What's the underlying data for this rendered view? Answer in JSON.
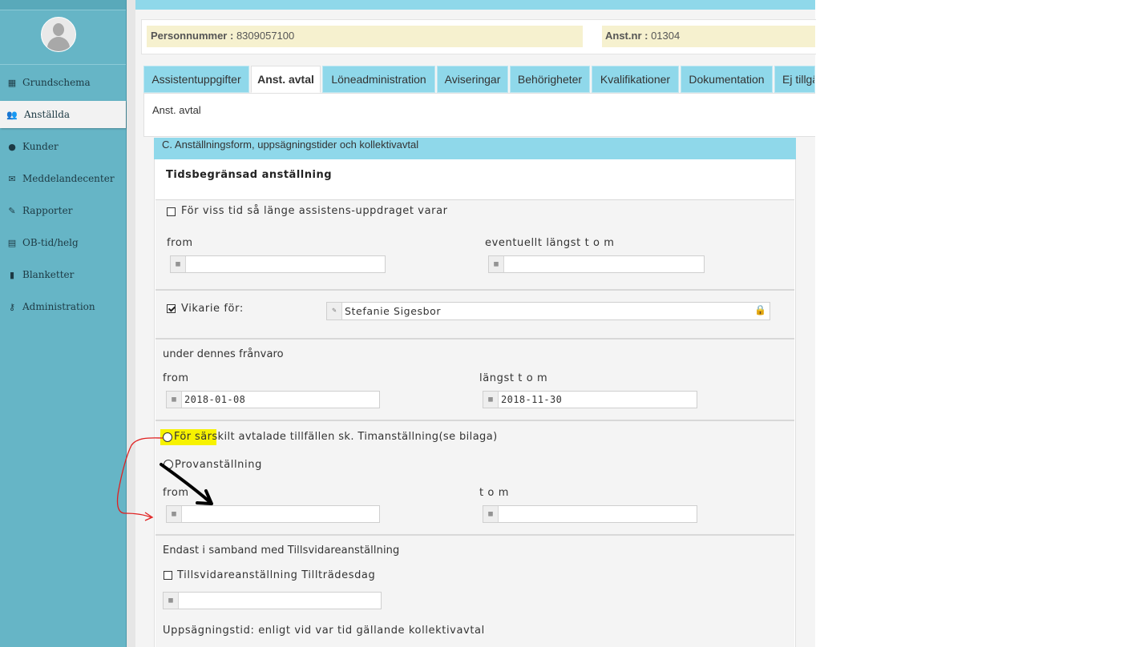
{
  "sidebar": {
    "items": [
      {
        "label": "Grundschema",
        "icon": "calendar-icon"
      },
      {
        "label": "Anställda",
        "icon": "users-icon"
      },
      {
        "label": "Kunder",
        "icon": "user-icon"
      },
      {
        "label": "Meddelandecenter",
        "icon": "envelope-icon"
      },
      {
        "label": "Rapporter",
        "icon": "pencil-icon"
      },
      {
        "label": "OB-tid/helg",
        "icon": "chart-icon"
      },
      {
        "label": "Blanketter",
        "icon": "file-icon"
      },
      {
        "label": "Administration",
        "icon": "key-icon"
      }
    ],
    "active": "Anställda"
  },
  "info": {
    "personnummer_label": "Personnummer :",
    "personnummer_value": "8309057100",
    "anstnr_label": "Anst.nr :",
    "anstnr_value": "01304"
  },
  "tabs": [
    {
      "label": "Assistentuppgifter"
    },
    {
      "label": "Anst. avtal"
    },
    {
      "label": "Löneadministration"
    },
    {
      "label": "Aviseringar"
    },
    {
      "label": "Behörigheter"
    },
    {
      "label": "Kvalifikationer"
    },
    {
      "label": "Dokumentation"
    },
    {
      "label": "Ej tillgä"
    }
  ],
  "active_tab": "Anst. avtal",
  "tab_content_title": "Anst. avtal",
  "section": {
    "header": "C. Anställningsform, uppsägningstider och kollektivavtal",
    "subtitle": "Tidsbegränsad anställning",
    "viss_tid": {
      "checkbox_label": "För viss tid så länge assistens-uppdraget varar",
      "checked": false,
      "from_label": "from",
      "tom_label": "eventuellt längst t o m",
      "from_value": "",
      "tom_value": ""
    },
    "vikarie": {
      "checkbox_label": "Vikarie för:",
      "checked": true,
      "name_value": "Stefanie Sigesbor"
    },
    "franvaro": {
      "title": "under dennes frånvaro",
      "from_label": "from",
      "tom_label": "längst t o m",
      "from_value": "2018-01-08",
      "tom_value": "2018-11-30"
    },
    "timanstallning": {
      "radio1_label_highlight": "För särs",
      "radio1_label_rest": "kilt avtalade tillfällen sk. Timanställning(se bilaga)",
      "radio2_label": "Provanställning",
      "from_label": "from",
      "tom_label": "t o m",
      "from_value": "",
      "tom_value": ""
    },
    "tillsvidare": {
      "title": "Endast i samband med Tillsvidareanställning",
      "checkbox_label": "Tillsvidareanställning Tillträdesdag",
      "checked": false,
      "date_value": ""
    },
    "uppsagning": "Uppsägningstid: enligt vid var tid gällande kollektivavtal"
  },
  "colors": {
    "sidebar": "#66b5c6",
    "tab": "#8fd8ea",
    "highlight": "#f7f200",
    "red_annotation": "#e02020",
    "black_annotation": "#000000"
  }
}
